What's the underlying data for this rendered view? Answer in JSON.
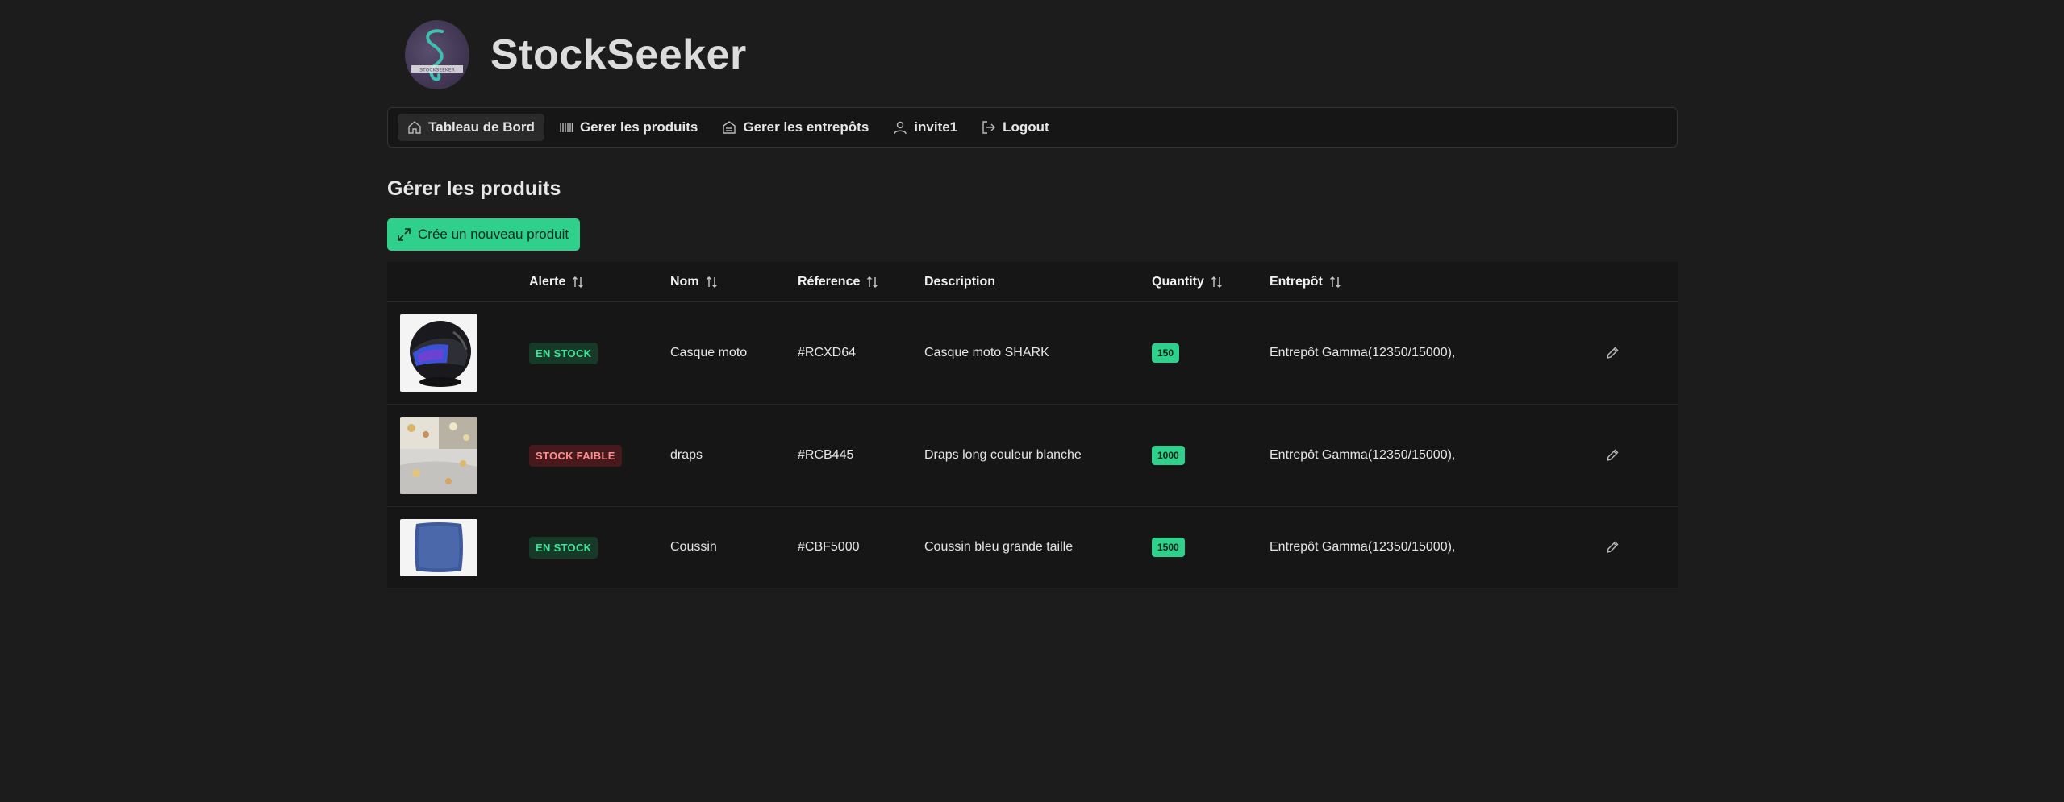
{
  "app": {
    "brand": "StockSeeker",
    "logo_text": "STOCKSEEKER"
  },
  "nav": {
    "items": [
      {
        "label": "Tableau de Bord",
        "icon": "home-icon",
        "active": true
      },
      {
        "label": "Gerer les produits",
        "icon": "barcode-icon"
      },
      {
        "label": "Gerer les entrepôts",
        "icon": "warehouse-icon"
      },
      {
        "label": "invite1",
        "icon": "user-icon"
      },
      {
        "label": "Logout",
        "icon": "logout-icon"
      }
    ]
  },
  "page": {
    "title": "Gérer les produits",
    "create_label": "Crée un nouveau produit"
  },
  "table": {
    "headers": {
      "alert": "Alerte",
      "name": "Nom",
      "ref": "Réference",
      "description": "Description",
      "quantity": "Quantity",
      "warehouse": "Entrepôt"
    },
    "rows": [
      {
        "alert": "EN STOCK",
        "alert_kind": "ok",
        "name": "Casque moto",
        "ref": "#RCXD64",
        "description": "Casque moto SHARK",
        "quantity": "150",
        "warehouse": "Entrepôt Gamma(12350/15000),",
        "image": "helmet-image"
      },
      {
        "alert": "STOCK FAIBLE",
        "alert_kind": "low",
        "name": "draps",
        "ref": "#RCB445",
        "description": "Draps long couleur blanche",
        "quantity": "1000",
        "warehouse": "Entrepôt Gamma(12350/15000),",
        "image": "bedsheet-image"
      },
      {
        "alert": "EN STOCK",
        "alert_kind": "ok",
        "name": "Coussin",
        "ref": "#CBF5000",
        "description": "Coussin bleu grande taille",
        "quantity": "1500",
        "warehouse": "Entrepôt Gamma(12350/15000),",
        "image": "cushion-image"
      }
    ]
  },
  "colors": {
    "background": "#1c1c1c",
    "accent": "#2fd08c",
    "in_stock_text": "#3fe39a",
    "low_stock_text": "#ff8f8f"
  }
}
